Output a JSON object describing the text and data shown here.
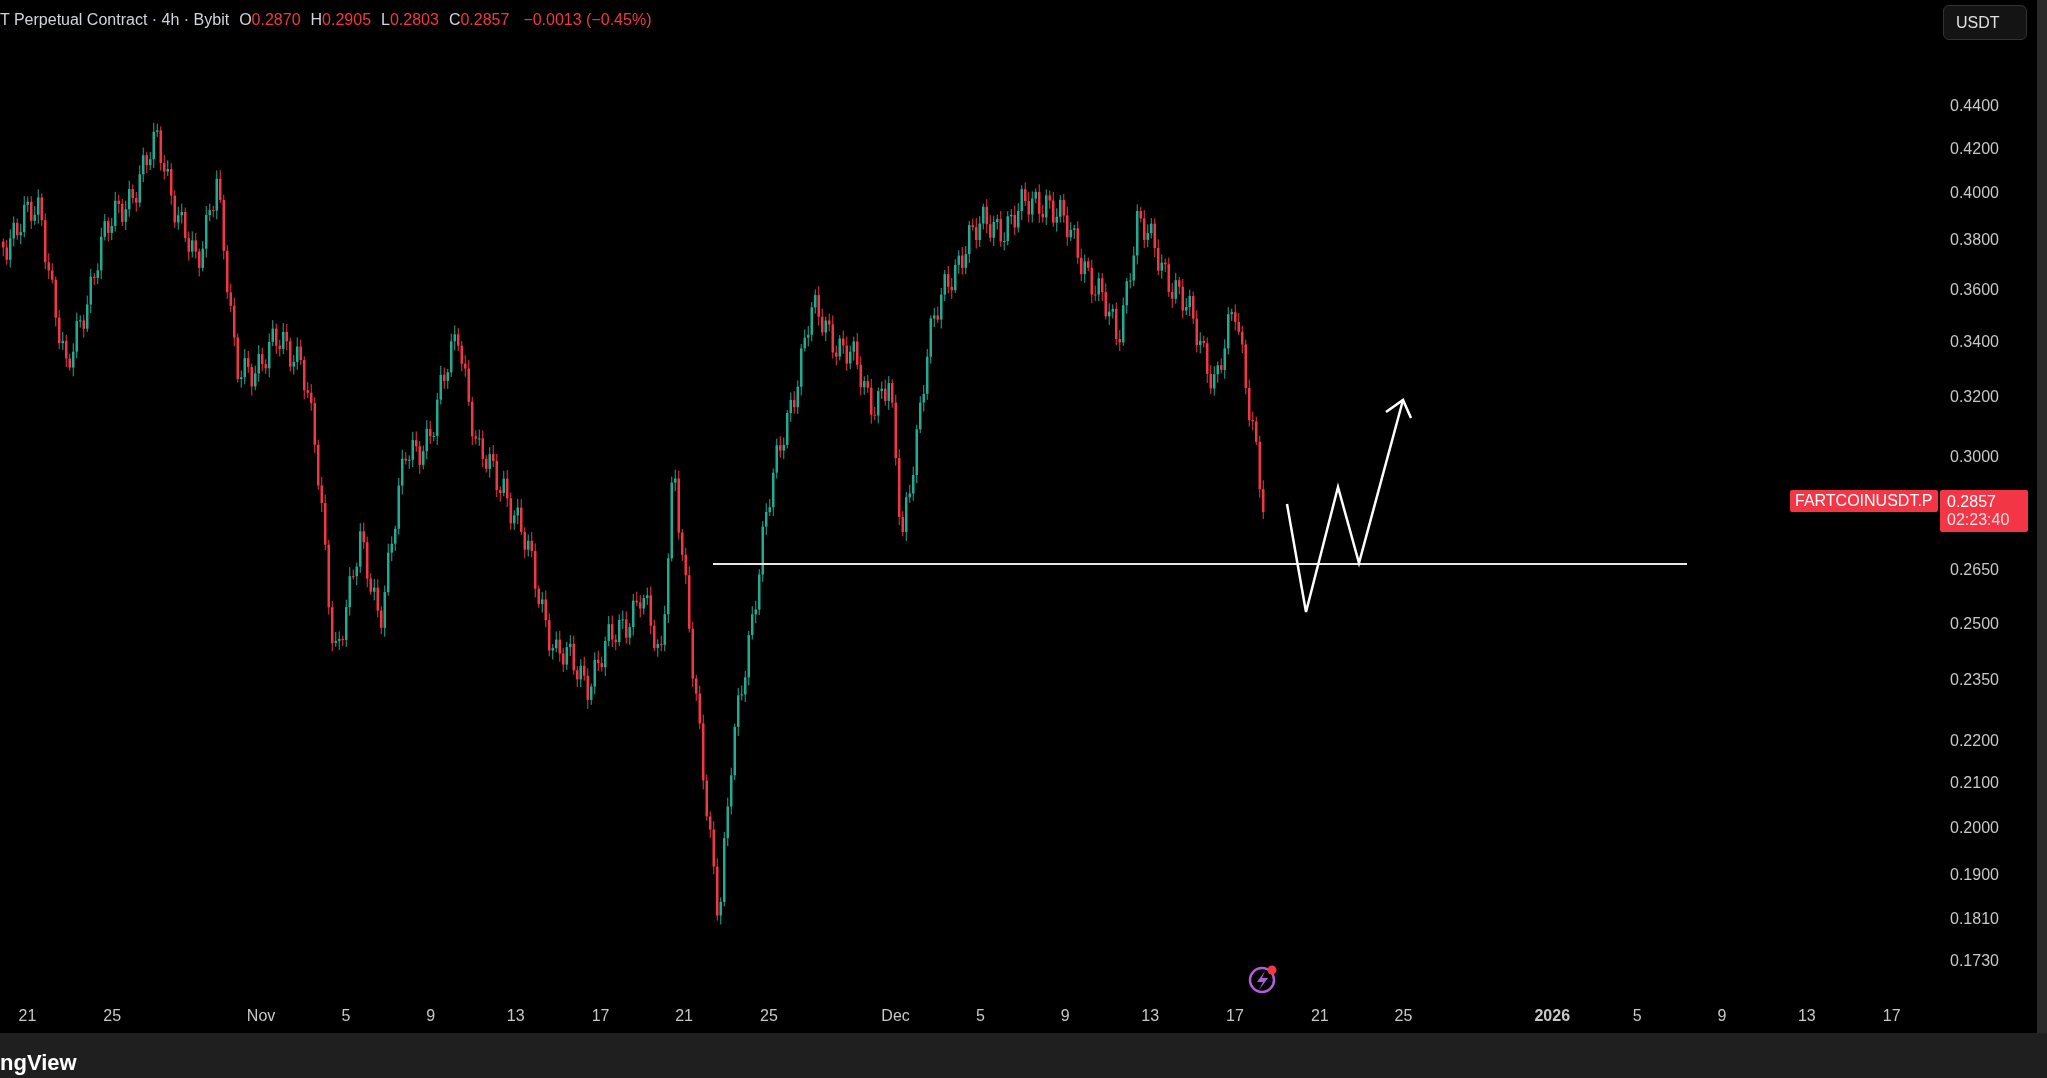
{
  "header": {
    "title": "T Perpetual Contract · 4h · Bybit",
    "ohlc": [
      {
        "letter": "O",
        "value": "0.2870"
      },
      {
        "letter": "H",
        "value": "0.2905"
      },
      {
        "letter": "L",
        "value": "0.2803"
      },
      {
        "letter": "C",
        "value": "0.2857"
      }
    ],
    "change": "−0.0013 (−0.45%)"
  },
  "currency_button": "USDT",
  "price_axis": [
    "0.4400",
    "0.4200",
    "0.4000",
    "0.3800",
    "0.3600",
    "0.3400",
    "0.3200",
    "0.3000",
    "0.2650",
    "0.2500",
    "0.2350",
    "0.2200",
    "0.2100",
    "0.2000",
    "0.1900",
    "0.1810",
    "0.1730"
  ],
  "symbol_tag": "FARTCOINUSDT.P",
  "last_price": {
    "price": "0.2857",
    "countdown": "02:23:40"
  },
  "time_axis": [
    {
      "text": "21",
      "bold": false
    },
    {
      "text": "25",
      "bold": false
    },
    {
      "text": "Nov",
      "bold": false
    },
    {
      "text": "5",
      "bold": false
    },
    {
      "text": "9",
      "bold": false
    },
    {
      "text": "13",
      "bold": false
    },
    {
      "text": "17",
      "bold": false
    },
    {
      "text": "21",
      "bold": false
    },
    {
      "text": "25",
      "bold": false
    },
    {
      "text": "Dec",
      "bold": false
    },
    {
      "text": "5",
      "bold": false
    },
    {
      "text": "9",
      "bold": false
    },
    {
      "text": "13",
      "bold": false
    },
    {
      "text": "17",
      "bold": false
    },
    {
      "text": "21",
      "bold": false
    },
    {
      "text": "25",
      "bold": false
    },
    {
      "text": "2026",
      "bold": true
    },
    {
      "text": "5",
      "bold": false
    },
    {
      "text": "9",
      "bold": false
    },
    {
      "text": "13",
      "bold": false
    },
    {
      "text": "17",
      "bold": false
    }
  ],
  "footer": {
    "logo": "ngView"
  }
}
